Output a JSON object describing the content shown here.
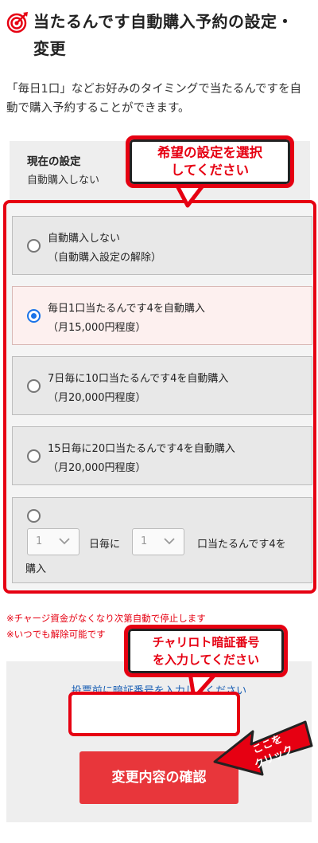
{
  "header": {
    "title": "当たるんです自動購入予約の設定・変更",
    "icon": "target-icon"
  },
  "description": "「毎日1口」などお好みのタイミングで当たるんですを自動で購入予約することができます。",
  "current": {
    "label": "現在の設定",
    "value": "自動購入しない"
  },
  "callout_select": {
    "line1": "希望の設定を選択",
    "line2": "してください"
  },
  "options": [
    {
      "line1": "自動購入しない",
      "line2": "（自動購入設定の解除）",
      "selected": false
    },
    {
      "line1": "毎日1口当たるんです4を自動購入",
      "line2": "（月15,000円程度）",
      "selected": true
    },
    {
      "line1": "7日毎に10口当たるんです4を自動購入",
      "line2": "（月20,000円程度）",
      "selected": false
    },
    {
      "line1": "15日毎に20口当たるんです4を自動購入",
      "line2": "（月20,000円程度）",
      "selected": false
    }
  ],
  "custom_option": {
    "days_value": "1",
    "days_suffix": "日毎に",
    "count_value": "1",
    "count_suffix": "口当たるんです4を",
    "trailing": "購入"
  },
  "notes": [
    "※チャージ資金がなくなり次第自動で停止します",
    "※いつでも解除可能です"
  ],
  "callout_pin": {
    "line1": "チャリロト暗証番号",
    "line2": "を入力してください"
  },
  "pin": {
    "label": "投票前に暗証番号を入力してください",
    "value": ""
  },
  "submit_label": "変更内容の確認",
  "click_callout": {
    "line1": "ここを",
    "line2": "クリック"
  },
  "colors": {
    "accent_red": "#e60012",
    "button_red": "#e8363b",
    "radio_blue": "#1a73e8"
  }
}
